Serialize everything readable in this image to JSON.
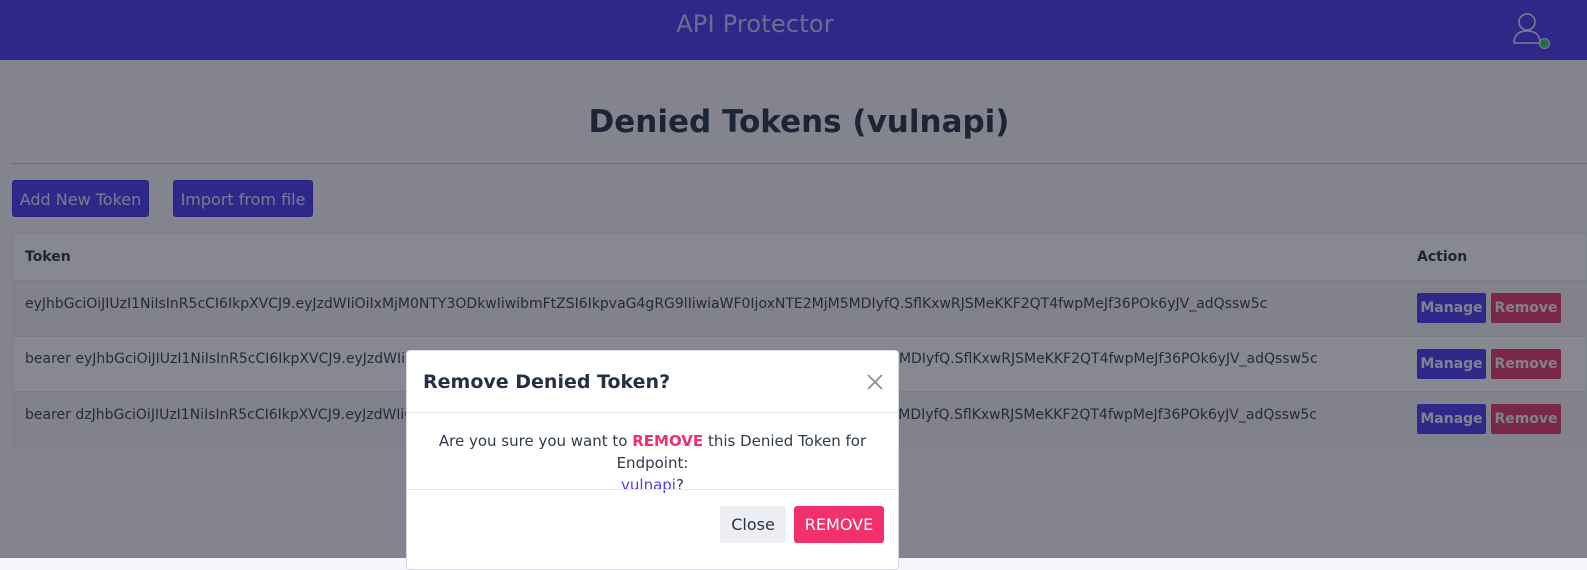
{
  "navbar": {
    "brand": "API Protector"
  },
  "page": {
    "title": "Denied Tokens (vulnapi)",
    "add_button": "Add New Token",
    "import_button": "Import from file"
  },
  "table": {
    "columns": [
      "Token",
      "Action"
    ],
    "rows": [
      {
        "token": "eyJhbGciOiJIUzI1NiIsInR5cCI6IkpXVCJ9.eyJzdWIiOiIxMjM0NTY3ODkwIiwibmFtZSI6IkpvaG4gRG9lIiwiaWF0IjoxNTE2MjM5MDIyfQ.SflKxwRJSMeKKF2QT4fwpMeJf36POk6yJV_adQssw5c"
      },
      {
        "token": "bearer eyJhbGciOiJIUzI1NiIsInR5cCI6IkpXVCJ9.eyJzdWIiOiIxMjM0NTY3ODkwIiwibmFtZSI6IkpvaG4gRG9lIiwiaWF0IjoxNTE2MjM5MDIyfQ.SflKxwRJSMeKKF2QT4fwpMeJf36POk6yJV_adQssw5c"
      },
      {
        "token": "bearer dzJhbGciOiJIUzI1NiIsInR5cCI6IkpXVCJ9.eyJzdWIiOiIxMjM0NTY3ODkwIiwibmFtZSI6IkpvaG4gRG9lIiwiaWF0IjoxNTE2MjM5MDIyfQ.SflKxwRJSMeKKF2QT4fwpMeJf36POk6yJV_adQssw5c"
      }
    ],
    "manage_label": "Manage",
    "remove_label": "Remove"
  },
  "modal": {
    "title": "Remove Denied Token?",
    "body_prefix": "Are you sure you want to",
    "body_highlight": "REMOVE",
    "body_suffix": "this Denied Token for Endpoint:",
    "endpoint": "vulnapi",
    "endpoint_suffix": "?",
    "close_label": "Close",
    "confirm_label": "REMOVE"
  },
  "colors": {
    "primary": "#4b3ff0",
    "danger": "#e43b6c",
    "status_online": "#2ec46a"
  },
  "icons": {
    "user": "user-outline-icon",
    "close": "close-x-icon"
  }
}
